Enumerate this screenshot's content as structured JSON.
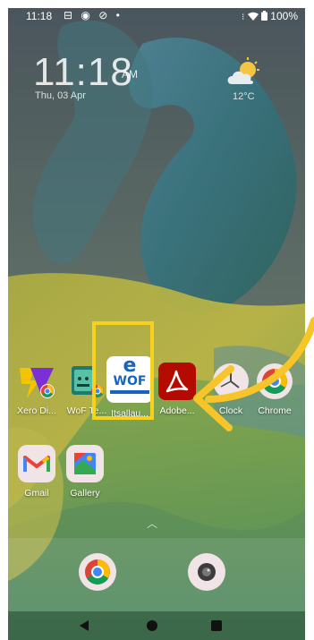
{
  "status_bar": {
    "time": "11:18",
    "notification_icons": [
      "sim-icon",
      "app-icon",
      "check-icon",
      "dot-icon"
    ],
    "battery": "100%",
    "right_icons": [
      "vibrate-icon",
      "wifi-icon",
      "battery-icon"
    ]
  },
  "clock_widget": {
    "time": "11:18",
    "ampm": "AM",
    "date": "Thu, 03 Apr"
  },
  "weather_widget": {
    "icon": "partly-cloudy-icon",
    "temperature": "12°C"
  },
  "apps_row1": [
    {
      "label": "Xero Di...",
      "icon": "xero-icon"
    },
    {
      "label": "WoF Te...",
      "icon": "wof-teams-icon"
    },
    {
      "label": "Itsallau...",
      "icon": "wof-app-icon"
    },
    {
      "label": "Adobe...",
      "icon": "adobe-acrobat-icon"
    },
    {
      "label": "Clock",
      "icon": "clock-icon"
    },
    {
      "label": "Chrome",
      "icon": "chrome-icon"
    }
  ],
  "apps_row2": [
    {
      "label": "Gmail",
      "icon": "gmail-icon"
    },
    {
      "label": "Gallery",
      "icon": "gallery-icon"
    }
  ],
  "wof_logo": {
    "letter": "e",
    "text": "WOF"
  },
  "dock": [
    "chrome-icon",
    "camera-icon"
  ],
  "nav_bar": [
    "back-icon",
    "home-icon",
    "recents-icon"
  ],
  "colors": {
    "highlight": "#f7d21c",
    "arrow": "#f7c52a",
    "wof_blue": "#1565c0",
    "wallpaper_yellow": "#d9d04a",
    "wallpaper_teal": "#3e8f9d"
  }
}
